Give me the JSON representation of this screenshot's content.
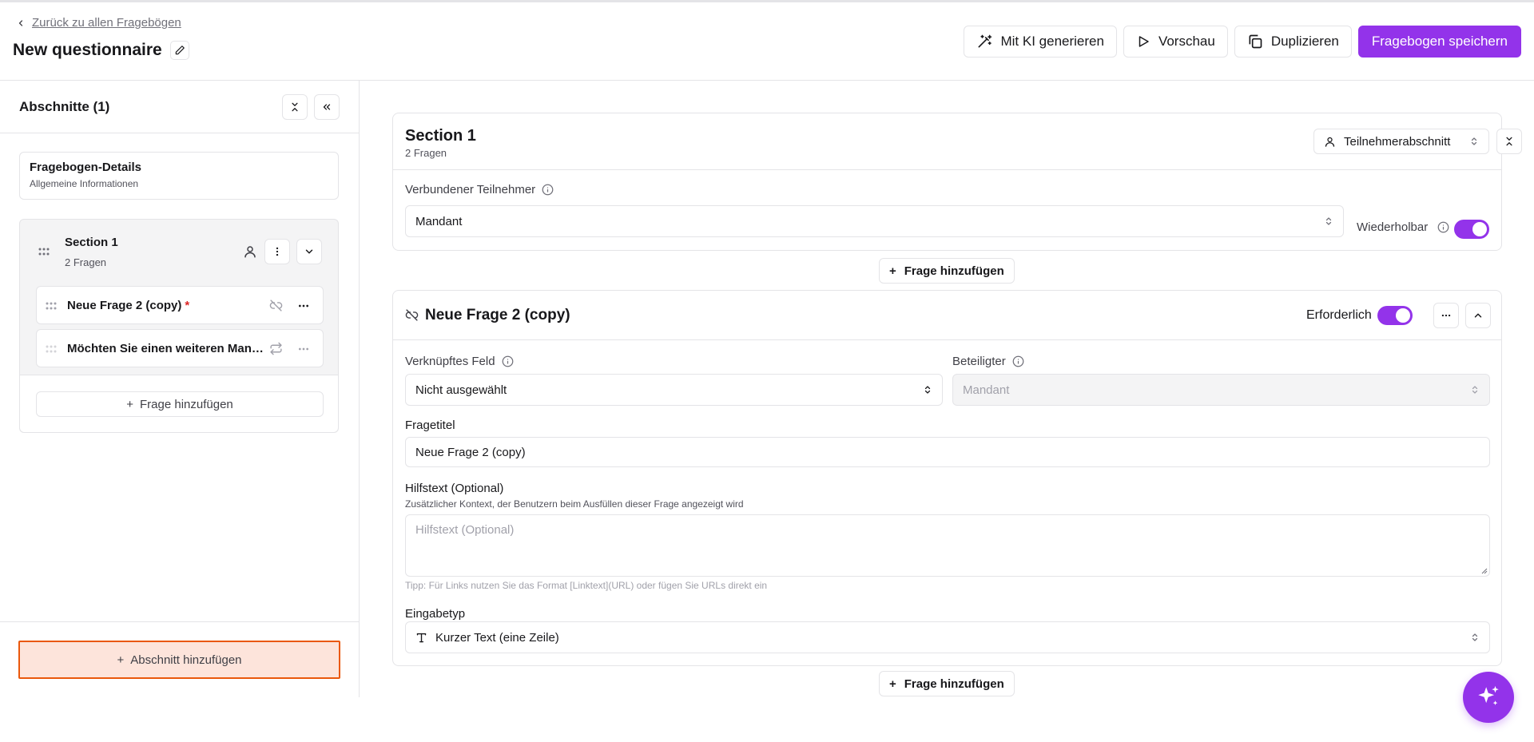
{
  "header": {
    "back_label": "Zurück zu allen Fragebögen",
    "title": "New questionnaire",
    "actions": {
      "ai_label": "Mit KI generieren",
      "preview_label": "Vorschau",
      "duplicate_label": "Duplizieren",
      "save_label": "Fragebogen speichern"
    }
  },
  "sidebar": {
    "title": "Abschnitte (1)",
    "details": {
      "title": "Fragebogen-Details",
      "subtitle": "Allgemeine Informationen"
    },
    "section": {
      "name": "Section 1",
      "count": "2 Fragen",
      "questions": [
        {
          "label": "Neue Frage 2 (copy)",
          "required_mark": "*"
        },
        {
          "label": "Möchten Sie einen weiteren Mandanten hinzufügen?"
        }
      ],
      "add_question_label": "Frage hinzufügen"
    },
    "add_section_label": "Abschnitt hinzufügen"
  },
  "main": {
    "section": {
      "title": "Section 1",
      "count": "2 Fragen",
      "type_select": "Teilnehmerabschnitt",
      "participant_label": "Verbundener Teilnehmer",
      "participant_value": "Mandant",
      "repeatable_label": "Wiederholbar",
      "repeatable_on": true
    },
    "add_question_label": "Frage hinzufügen",
    "question": {
      "title": "Neue Frage 2 (copy)",
      "required_label": "Erforderlich",
      "required_on": true,
      "linked_field_label": "Verknüpftes Feld",
      "linked_field_value": "Nicht ausgewählt",
      "participant_label": "Beteiligter",
      "participant_value": "Mandant",
      "question_title_label": "Fragetitel",
      "question_title_value": "Neue Frage 2 (copy)",
      "help_label": "Hilfstext (Optional)",
      "help_sub": "Zusätzlicher Kontext, der Benutzern beim Ausfüllen dieser Frage angezeigt wird",
      "help_placeholder": "Hilfstext (Optional)",
      "tip": "Tipp: Für Links nutzen Sie das Format [Linktext](URL) oder fügen Sie URLs direkt ein",
      "input_type_label": "Eingabetyp",
      "input_type_value": "Kurzer Text (eine Zeile)"
    }
  },
  "colors": {
    "accent": "#9333ea",
    "highlight_border": "#ea580c",
    "highlight_fill": "#fde4db",
    "required": "#dc2626"
  }
}
